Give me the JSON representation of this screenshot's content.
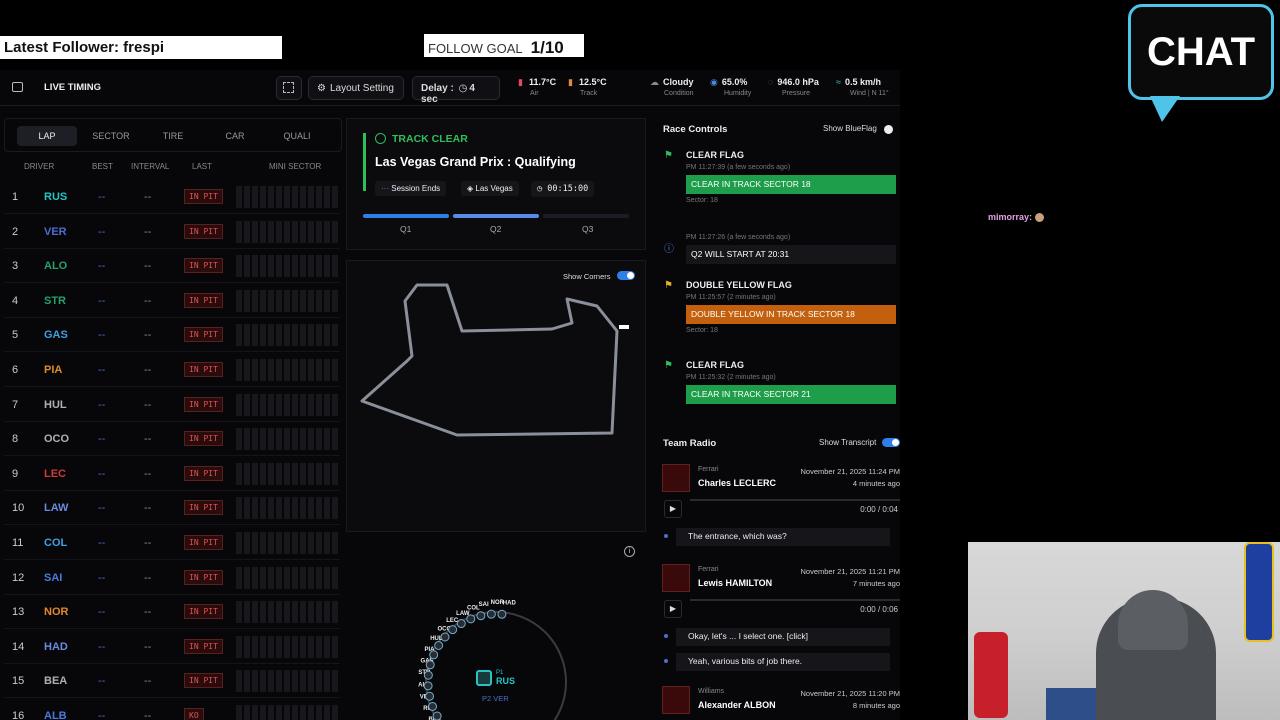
{
  "overlay": {
    "latest_follower": "Latest Follower: frespi",
    "follow_goal_label": "FOLLOW GOAL",
    "follow_goal_value": "1/10",
    "chat_logo": "CHAT",
    "chat_message": "mimorray:"
  },
  "header": {
    "title": "LIVE TIMING",
    "layout_setting": "Layout Setting",
    "delay_label": "Delay :",
    "delay_value": "4 sec"
  },
  "weather": [
    {
      "value": "11.7°C",
      "label": "Air"
    },
    {
      "value": "12.5°C",
      "label": "Track"
    },
    {
      "value": "Cloudy",
      "label": "Condition"
    },
    {
      "value": "65.0%",
      "label": "Humidity"
    },
    {
      "value": "946.0 hPa",
      "label": "Pressure"
    },
    {
      "value": "0.5 km/h",
      "label": "Wind | N 11°"
    }
  ],
  "timing": {
    "tabs": [
      "LAP",
      "SECTOR",
      "TIRE",
      "CAR",
      "QUALI"
    ],
    "columns": [
      "DRIVER",
      "BEST",
      "INTERVAL",
      "LAST",
      "MINI SECTOR"
    ],
    "rows": [
      {
        "pos": "1",
        "code": "RUS",
        "color": "#27c4c4",
        "best": "--",
        "interval": "--",
        "status": "IN PIT"
      },
      {
        "pos": "2",
        "code": "VER",
        "color": "#4a6fd0",
        "best": "--",
        "interval": "--",
        "status": "IN PIT"
      },
      {
        "pos": "3",
        "code": "ALO",
        "color": "#27a06a",
        "best": "--",
        "interval": "--",
        "status": "IN PIT"
      },
      {
        "pos": "4",
        "code": "STR",
        "color": "#27a06a",
        "best": "--",
        "interval": "--",
        "status": "IN PIT"
      },
      {
        "pos": "5",
        "code": "GAS",
        "color": "#3fa0e0",
        "best": "--",
        "interval": "--",
        "status": "IN PIT"
      },
      {
        "pos": "6",
        "code": "PIA",
        "color": "#e08a2a",
        "best": "--",
        "interval": "--",
        "status": "IN PIT"
      },
      {
        "pos": "7",
        "code": "HUL",
        "color": "#b0b0b0",
        "best": "--",
        "interval": "--",
        "status": "IN PIT"
      },
      {
        "pos": "8",
        "code": "OCO",
        "color": "#b0b0b0",
        "best": "--",
        "interval": "--",
        "status": "IN PIT"
      },
      {
        "pos": "9",
        "code": "LEC",
        "color": "#d03a3a",
        "best": "--",
        "interval": "--",
        "status": "IN PIT"
      },
      {
        "pos": "10",
        "code": "LAW",
        "color": "#6a8ae0",
        "best": "--",
        "interval": "--",
        "status": "IN PIT"
      },
      {
        "pos": "11",
        "code": "COL",
        "color": "#3fa0e0",
        "best": "--",
        "interval": "--",
        "status": "IN PIT"
      },
      {
        "pos": "12",
        "code": "SAI",
        "color": "#4a7ae0",
        "best": "--",
        "interval": "--",
        "status": "IN PIT"
      },
      {
        "pos": "13",
        "code": "NOR",
        "color": "#e08a2a",
        "best": "--",
        "interval": "--",
        "status": "IN PIT"
      },
      {
        "pos": "14",
        "code": "HAD",
        "color": "#6a8ae0",
        "best": "--",
        "interval": "--",
        "status": "IN PIT"
      },
      {
        "pos": "15",
        "code": "BEA",
        "color": "#b0b0b0",
        "best": "--",
        "interval": "--",
        "status": "IN PIT"
      },
      {
        "pos": "16",
        "code": "ALB",
        "color": "#4a7ae0",
        "best": "--",
        "interval": "--",
        "status": "KO"
      }
    ]
  },
  "session": {
    "status": "TRACK CLEAR",
    "title": "Las Vegas Grand Prix : Qualifying",
    "session_ends": "Session Ends",
    "location": "Las Vegas",
    "timer": "00:15:00",
    "segments": [
      "Q1",
      "Q2",
      "Q3"
    ]
  },
  "map": {
    "show_corners": "Show Corners"
  },
  "race_controls": {
    "title": "Race Controls",
    "show_blueflag": "Show BlueFlag",
    "items": [
      {
        "title": "CLEAR FLAG",
        "time": "PM 11:27:39 (a few seconds ago)",
        "message": "CLEAR IN TRACK SECTOR 18",
        "color": "#1e9e4a",
        "sector": "Sector: 18"
      },
      {
        "title": "",
        "time": "PM 11:27:26 (a few seconds ago)",
        "message": "Q2 WILL START AT 20:31",
        "color": "#15151a",
        "sector": ""
      },
      {
        "title": "DOUBLE YELLOW FLAG",
        "time": "PM 11:25:57 (2 minutes ago)",
        "message": "DOUBLE YELLOW IN TRACK SECTOR 18",
        "color": "#c2600e",
        "sector": "Sector: 18"
      },
      {
        "title": "CLEAR FLAG",
        "time": "PM 11:25:32 (2 minutes ago)",
        "message": "CLEAR IN TRACK SECTOR 21",
        "color": "#1e9e4a",
        "sector": ""
      }
    ]
  },
  "team_radio": {
    "title": "Team Radio",
    "show_transcript": "Show Transcript",
    "items": [
      {
        "team": "Ferrari",
        "name": "Charles LECLERC",
        "date": "November 21, 2025 11:24 PM",
        "ago": "4 minutes ago",
        "time": "0:00 / 0:04",
        "transcript": [
          "The entrance, which was?"
        ]
      },
      {
        "team": "Ferrari",
        "name": "Lewis HAMILTON",
        "date": "November 21, 2025 11:21 PM",
        "ago": "7 minutes ago",
        "time": "0:00 / 0:06",
        "transcript": [
          "Okay, let's ... I select one. [click]",
          "Yeah, various bits of job there."
        ]
      },
      {
        "team": "Williams",
        "name": "Alexander ALBON",
        "date": "November 21, 2025 11:20 PM",
        "ago": "8 minutes ago",
        "time": "",
        "transcript": []
      }
    ]
  },
  "radar": {
    "labels": [
      "BEA",
      "RUS",
      "VER",
      "ALO",
      "STR",
      "GAS",
      "PIA",
      "HUL",
      "OCO",
      "LEC",
      "LAW",
      "COL",
      "SAI",
      "NOR",
      "HAD"
    ],
    "p1_label": "P1",
    "p1_code": "RUS",
    "p2_label": "P2 VER"
  }
}
